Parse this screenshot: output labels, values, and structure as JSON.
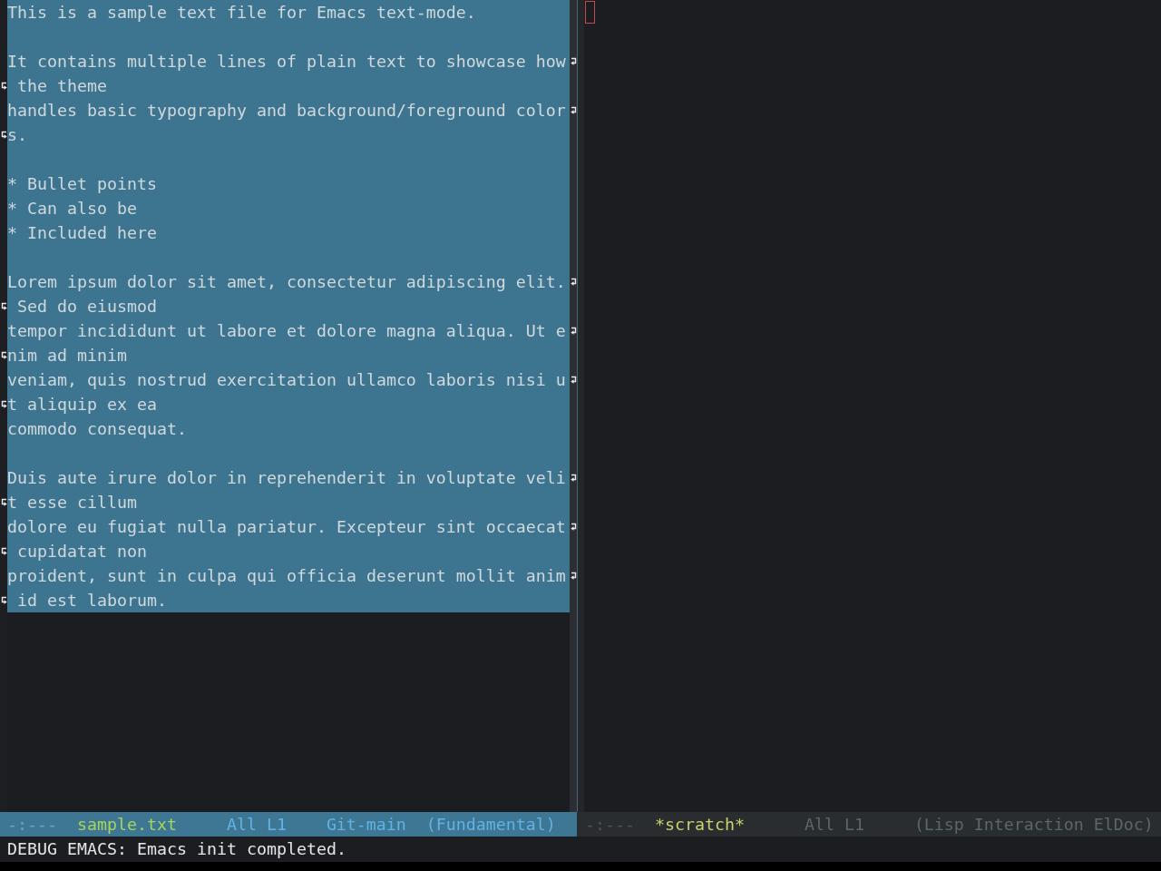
{
  "windows": [
    {
      "selected": true,
      "region": true,
      "paragraphs": [
        {
          "rows": [
            {
              "text": "This is a sample text file for Emacs text-mode.",
              "wrapped": false
            }
          ]
        },
        {
          "rows": [
            {
              "text": "It contains multiple lines of plain text to showcase how",
              "wrapped": true
            },
            {
              "text": " the theme",
              "wrapped": false
            },
            {
              "text": "handles basic typography and background/foreground color",
              "wrapped": true
            },
            {
              "text": "s.",
              "wrapped": false
            }
          ]
        },
        {
          "rows": [
            {
              "text": "* Bullet points",
              "wrapped": false
            },
            {
              "text": "* Can also be",
              "wrapped": false
            },
            {
              "text": "* Included here",
              "wrapped": false
            }
          ]
        },
        {
          "rows": [
            {
              "text": "Lorem ipsum dolor sit amet, consectetur adipiscing elit.",
              "wrapped": true
            },
            {
              "text": " Sed do eiusmod",
              "wrapped": false
            },
            {
              "text": "tempor incididunt ut labore et dolore magna aliqua. Ut e",
              "wrapped": true
            },
            {
              "text": "nim ad minim",
              "wrapped": false
            },
            {
              "text": "veniam, quis nostrud exercitation ullamco laboris nisi u",
              "wrapped": true
            },
            {
              "text": "t aliquip ex ea",
              "wrapped": false
            },
            {
              "text": "commodo consequat.",
              "wrapped": false
            }
          ]
        },
        {
          "rows": [
            {
              "text": "Duis aute irure dolor in reprehenderit in voluptate veli",
              "wrapped": true
            },
            {
              "text": "t esse cillum",
              "wrapped": false
            },
            {
              "text": "dolore eu fugiat nulla pariatur. Excepteur sint occaecat",
              "wrapped": true
            },
            {
              "text": " cupidatat non",
              "wrapped": false
            },
            {
              "text": "proident, sunt in culpa qui officia deserunt mollit anim",
              "wrapped": true
            },
            {
              "text": " id est laborum.",
              "wrapped": false
            }
          ]
        }
      ],
      "mode_line": [
        {
          "kind": "status",
          "text": "-:---"
        },
        {
          "kind": "buffer",
          "text": "sample.txt"
        },
        {
          "kind": "position",
          "text": "All L1"
        },
        {
          "kind": "vc",
          "text": "Git-main"
        },
        {
          "kind": "mode",
          "text": "(Fundamental)"
        }
      ]
    },
    {
      "selected": false,
      "cursor": true,
      "mode_line": [
        {
          "kind": "status",
          "text": "-:---"
        },
        {
          "kind": "buffer",
          "text": "*scratch*"
        },
        {
          "kind": "position",
          "text": "All L1"
        },
        {
          "kind": "mode",
          "text": "(Lisp Interaction ElDoc)"
        }
      ]
    }
  ],
  "echo_area": {
    "message": "DEBUG EMACS: Emacs init completed."
  }
}
